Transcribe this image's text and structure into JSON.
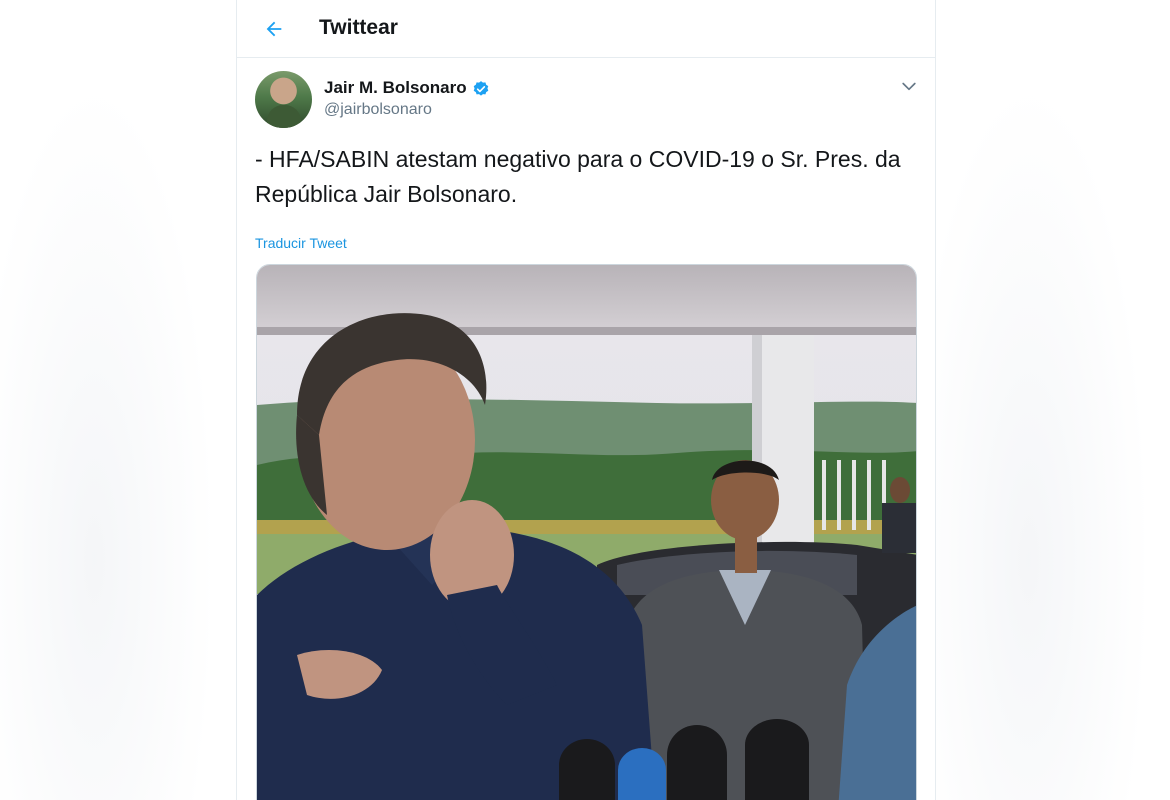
{
  "header": {
    "title": "Twittear",
    "back_icon": "arrow-left-icon"
  },
  "tweet": {
    "author": {
      "name": "Jair M. Bolsonaro",
      "handle": "@jairbolsonaro",
      "verified": true,
      "verified_icon": "verified-badge-icon"
    },
    "menu_icon": "chevron-down-icon",
    "text": "- HFA/SABIN atestam negativo para o COVID-19 o Sr. Pres. da República Jair Bolsonaro.",
    "translate_label": "Traducir Tweet"
  },
  "colors": {
    "accent": "#1da1f2",
    "link": "#1b95e0",
    "text": "#14171a",
    "secondary": "#657786",
    "border": "#e6ecf0"
  }
}
